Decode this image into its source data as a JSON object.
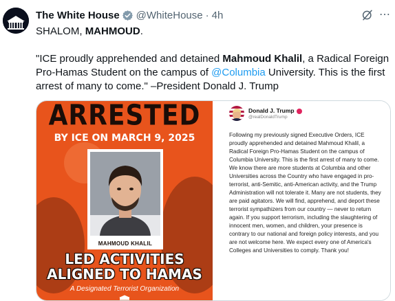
{
  "tweet": {
    "display_name": "The White House",
    "handle": "@WhiteHouse",
    "separator": "·",
    "time": "4h",
    "line1_prefix": "SHALOM,",
    "line1_bold": "MAHMOUD",
    "line1_suffix": ".",
    "quote_open": "\"ICE proudly apprehended and detained ",
    "quote_bold": "Mahmoud Khalil",
    "quote_mid": ", a Radical Foreign Pro-Hamas Student on the campus of ",
    "mention": "@Columbia",
    "quote_end": " University. This is the first arrest of many to come.\" –President Donald J. Trump"
  },
  "poster": {
    "title": "ARRESTED",
    "date_line": "BY ICE ON MARCH 9, 2025",
    "name_caption": "MAHMOUD KHALIL",
    "led_line1": "LED ACTIVITIES",
    "led_line2": "ALIGNED TO HAMAS",
    "subtitle": "A Designated Terrorist Organization"
  },
  "truth_post": {
    "name": "Donald J. Trump",
    "handle": "@realDonaldTrump",
    "body": "Following my previously signed Executive Orders, ICE proudly apprehended and detained Mahmoud Khalil, a Radical Foreign Pro-Hamas Student on the campus of Columbia University. This is the first arrest of many to come. We know there are more students at Columbia and other Universities across the Country who have engaged in pro-terrorist, anti-Semitic, anti-American activity, and the Trump Administration will not tolerate it. Many are not students, they are paid agitators. We will find, apprehend, and deport these terrorist sympathizers from our country — never to return again. If you support terrorism, including the slaughtering of innocent men, women, and children, your presence is contrary to our national and foreign policy interests, and you are not welcome here. We expect every one of America's Colleges and Universities to comply. Thank you!"
  },
  "icons": {
    "verified": "verified-badge-icon",
    "grok": "grok-icon",
    "more": "more-icon"
  },
  "colors": {
    "verified_gray": "#829aab",
    "link_blue": "#1d9bf0",
    "poster_orange": "#e8541c",
    "secondary_text": "#536471"
  }
}
